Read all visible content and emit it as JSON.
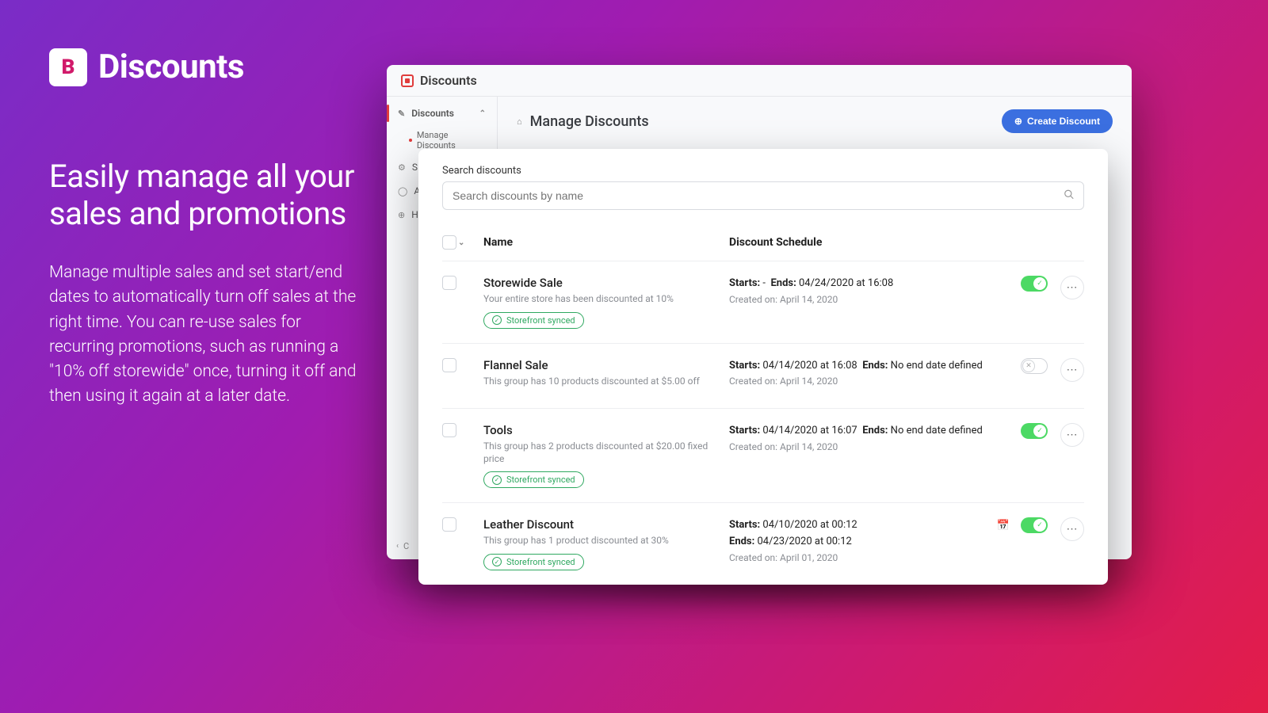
{
  "promo": {
    "logo_letter": "B",
    "title": "Discounts",
    "headline": "Easily manage all your sales and promotions",
    "body": "Manage multiple sales and set start/end dates to automatically turn off sales at the right time. You can re-use sales for recurring promotions, such as running a \"10% off storewide\" once, turning it off and then using it again at a later date."
  },
  "app": {
    "title": "Discounts",
    "sidebar": {
      "main": "Discounts",
      "sub": "Manage Discounts",
      "items": [
        "S",
        "A",
        "H"
      ],
      "footer": "C"
    },
    "page_heading": "Manage Discounts",
    "create_button": "Create Discount"
  },
  "search": {
    "label": "Search discounts",
    "placeholder": "Search discounts by name"
  },
  "columns": {
    "name": "Name",
    "schedule": "Discount Schedule"
  },
  "synced_label": "Storefront synced",
  "rows": [
    {
      "name": "Storewide Sale",
      "desc": "Your entire store has been discounted at 10%",
      "synced": true,
      "starts": "-",
      "ends": "04/24/2020 at 16:08",
      "schedule_inline": true,
      "created": "Created on: April 14, 2020",
      "toggle": "on",
      "calendar": false
    },
    {
      "name": "Flannel Sale",
      "desc": "This group has 10 products discounted at $5.00 off",
      "synced": false,
      "starts": "04/14/2020 at 16:08",
      "ends": "No end date defined",
      "schedule_inline": true,
      "created": "Created on: April 14, 2020",
      "toggle": "off",
      "calendar": false
    },
    {
      "name": "Tools",
      "desc": "This group has 2 products discounted at $20.00 fixed price",
      "synced": true,
      "starts": "04/14/2020 at 16:07",
      "ends": "No end date defined",
      "schedule_inline": true,
      "created": "Created on: April 14, 2020",
      "toggle": "on",
      "calendar": false
    },
    {
      "name": "Leather Discount",
      "desc": "This group has 1 product discounted at 30%",
      "synced": true,
      "starts": "04/10/2020 at 00:12",
      "ends": "04/23/2020 at 00:12",
      "schedule_inline": false,
      "created": "Created on: April 01, 2020",
      "toggle": "on",
      "calendar": true
    }
  ]
}
